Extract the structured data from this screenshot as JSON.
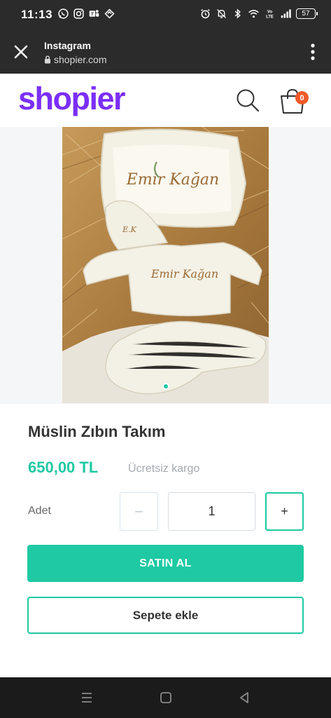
{
  "status_bar": {
    "time": "11:13",
    "battery": "57",
    "left_icons": [
      "whatsapp-icon",
      "instagram-icon",
      "teams-icon",
      "app-icon"
    ],
    "right_icons": [
      "alarm-icon",
      "mute-icon",
      "bluetooth-icon",
      "wifi-icon",
      "volte-icon",
      "signal-icon"
    ]
  },
  "browser": {
    "title": "Instagram",
    "url": "shopier.com"
  },
  "site": {
    "logo": "shopier",
    "cart_count": "0",
    "brand_color": "#7b2ff7",
    "accent_color": "#1ec9a3"
  },
  "product": {
    "title": "Müslin Zıbın Takım",
    "price": "650,00 TL",
    "shipping": "Ücretsiz kargo",
    "quantity_label": "Adet",
    "quantity_value": "1",
    "minus_label": "–",
    "plus_label": "+",
    "buy_label": "SATIN AL",
    "add_to_cart_label": "Sepete ekle",
    "embroidery_name": "Emir Kağan",
    "embroidery_initials": "E.K",
    "image_count": 1,
    "active_image": 1
  }
}
